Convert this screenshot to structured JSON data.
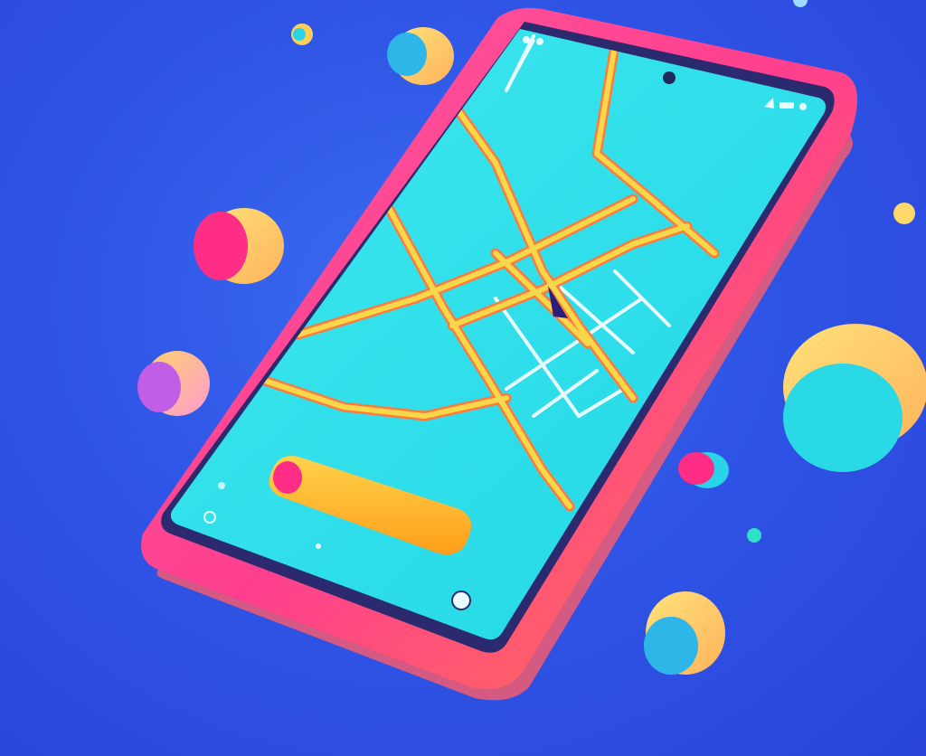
{
  "scene": {
    "description_label": "",
    "colors": {
      "background": "#3158e6",
      "phone_frame": "#ff3f8e",
      "phone_frame_highlight": "#ff7aa6",
      "bezel": "#2b2a6e",
      "screen": "#2ee0ea",
      "roads": "#f7c23a",
      "road_outline": "#ff7a3c",
      "minor_roads": "#e8fbff",
      "bar": "#ffb21f",
      "bar_dot": "#ff2d86",
      "pin": "#2b1f7a"
    },
    "status_bar": {
      "icons": [
        "signal-icon",
        "battery-icon"
      ]
    },
    "floating_shapes": [
      "cylinder",
      "cylinder",
      "cylinder",
      "cylinder",
      "cylinder",
      "cylinder",
      "dot",
      "dot",
      "dot"
    ]
  }
}
